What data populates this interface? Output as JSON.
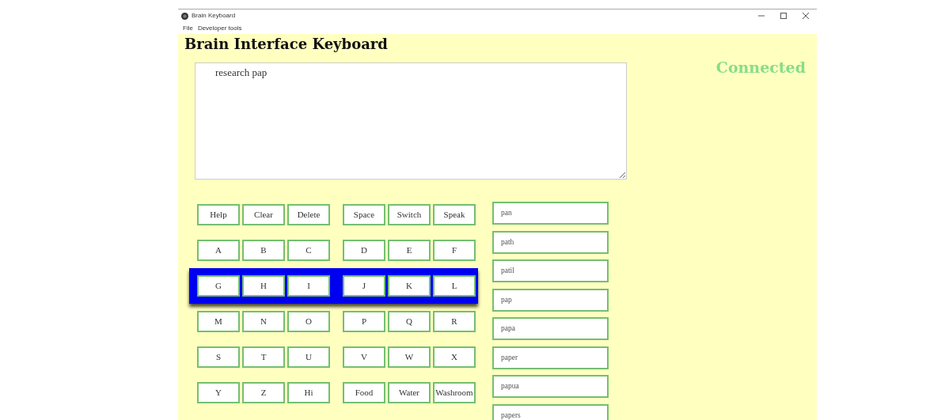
{
  "window": {
    "title": "Brain Keyboard"
  },
  "menu": [
    "File",
    "Developer tools"
  ],
  "heading": "Brain Interface Keyboard",
  "status": {
    "text": "Connected",
    "connected": true
  },
  "text_area": {
    "value": "research pap"
  },
  "key_rows": [
    {
      "selected": false,
      "keys": [
        "Help",
        "Clear",
        "Delete",
        "Space",
        "Switch",
        "Speak"
      ]
    },
    {
      "selected": false,
      "keys": [
        "A",
        "B",
        "C",
        "D",
        "E",
        "F"
      ]
    },
    {
      "selected": true,
      "keys": [
        "G",
        "H",
        "I",
        "J",
        "K",
        "L"
      ]
    },
    {
      "selected": false,
      "keys": [
        "M",
        "N",
        "O",
        "P",
        "Q",
        "R"
      ]
    },
    {
      "selected": false,
      "keys": [
        "S",
        "T",
        "U",
        "V",
        "W",
        "X"
      ]
    },
    {
      "selected": false,
      "keys": [
        "Y",
        "Z",
        "Hi",
        "Food",
        "Water",
        "Washroom"
      ]
    }
  ],
  "suggestions": [
    "pan",
    "path",
    "patil",
    "pap",
    "papa",
    "paper",
    "papua",
    "papers"
  ]
}
